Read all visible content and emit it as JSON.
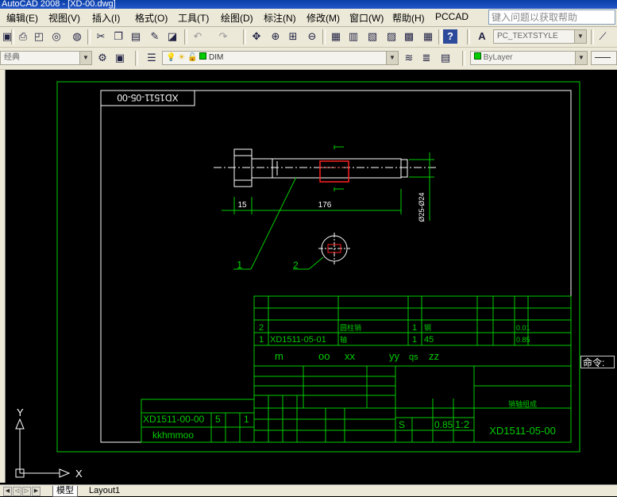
{
  "app": {
    "title": "AutoCAD 2008 - [XD-00.dwg]"
  },
  "menubar": {
    "items": [
      "编辑(E)",
      "视图(V)",
      "插入(I)",
      "格式(O)",
      "工具(T)",
      "绘图(D)",
      "标注(N)",
      "修改(M)",
      "窗口(W)",
      "帮助(H)",
      "PCCAD"
    ],
    "help_placeholder": "键入问题以获取帮助"
  },
  "toolbar": {
    "textstyle": "PC_TEXTSTYLE",
    "workspace": "经典",
    "layer": "DIM",
    "color": "ByLayer",
    "linetype": "ByLayer"
  },
  "drawing": {
    "part_code_top": "XD1511-05-00",
    "dim_left": "15",
    "dim_length": "176",
    "dim_dia": "Ø25-Ø24",
    "balloon_1": "1",
    "balloon_2": "2",
    "bom_rows": [
      {
        "no": "2",
        "code": "",
        "name": "圆柱销",
        "qty": "1",
        "material": "钢",
        "weight": "0.01"
      },
      {
        "no": "1",
        "code": "XD1511-05-01",
        "name": "轴",
        "qty": "1",
        "material": "45",
        "weight": "0.85"
      }
    ],
    "bom_header": [
      "m",
      "oo",
      "xx",
      "yy",
      "qs",
      "zz"
    ],
    "title_block": {
      "drawing_no": "XD1511-05-00",
      "drawing_name": "销轴组成",
      "weight": "0.85",
      "scale": "1:2",
      "stage": "S"
    },
    "left_block": {
      "code": "XD1511-00-00",
      "qty": "5",
      "count": "1",
      "label": "kkhmmoo"
    },
    "ucs": {
      "y": "Y",
      "x": "X"
    }
  },
  "command": {
    "label": "命令:"
  },
  "tabs": {
    "model": "模型",
    "layout1": "Layout1"
  }
}
